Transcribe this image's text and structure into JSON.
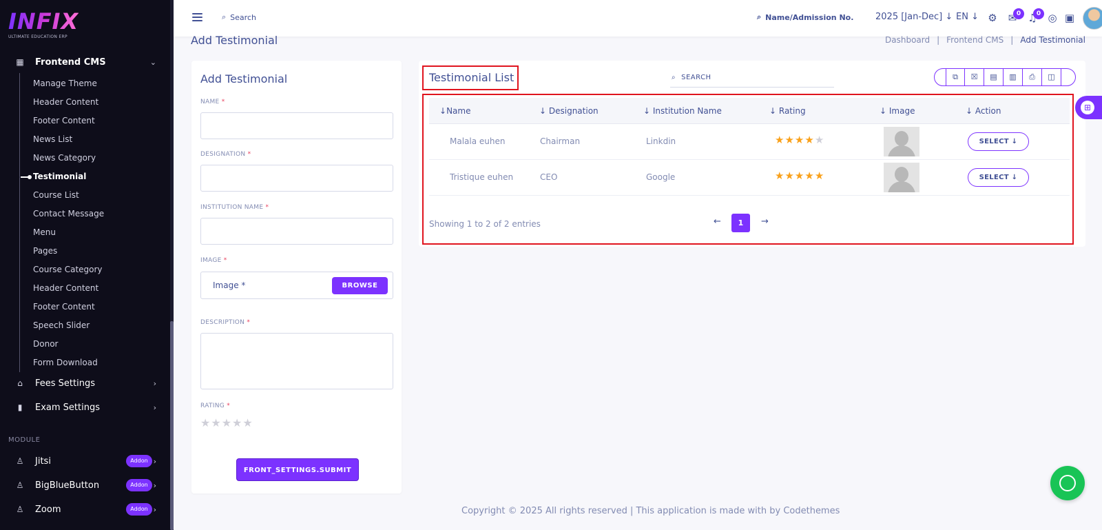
{
  "brand": {
    "logo": "INFIX",
    "tagline": "ULTIMATE EDUCATION ERP"
  },
  "sidebar": {
    "group_frontend": "Frontend CMS",
    "sub_items": [
      {
        "label": "Manage Theme"
      },
      {
        "label": "Header Content"
      },
      {
        "label": "Footer Content"
      },
      {
        "label": "News List"
      },
      {
        "label": "News Category"
      },
      {
        "label": "Testimonial",
        "active": true
      },
      {
        "label": "Course List"
      },
      {
        "label": "Contact Message"
      },
      {
        "label": "Menu"
      },
      {
        "label": "Pages"
      },
      {
        "label": "Course Category"
      },
      {
        "label": "Header Content"
      },
      {
        "label": "Footer Content"
      },
      {
        "label": "Speech Slider"
      },
      {
        "label": "Donor"
      },
      {
        "label": "Form Download"
      }
    ],
    "group_fees": "Fees Settings",
    "group_exam": "Exam Settings",
    "module_label": "MODULE",
    "modules": [
      {
        "label": "Jitsi",
        "badge": "Addon"
      },
      {
        "label": "BigBlueButton",
        "badge": "Addon"
      },
      {
        "label": "Zoom",
        "badge": "Addon"
      }
    ]
  },
  "topbar": {
    "search_label": "Search",
    "search2_label": "Name/Admission No.",
    "session": "2025 [Jan-Dec]",
    "lang": "EN",
    "chat_badge": "0",
    "notif_badge": "0"
  },
  "page": {
    "title": "Add Testimonial",
    "breadcrumb": [
      "Dashboard",
      "Frontend CMS",
      "Add Testimonial"
    ]
  },
  "form": {
    "heading": "Add Testimonial",
    "name_label": "NAME",
    "designation_label": "DESIGNATION",
    "institution_label": "INSTITUTION NAME",
    "image_label": "IMAGE",
    "image_placeholder": "Image *",
    "browse_label": "BROWSE",
    "description_label": "DESCRIPTION",
    "rating_label": "RATING",
    "rating_value": 0,
    "req_mark": "*",
    "submit_label": "FRONT_SETTINGS.SUBMIT"
  },
  "list": {
    "title": "Testimonial List",
    "search_placeholder": "SEARCH",
    "columns": [
      "Name",
      "Designation",
      "Institution Name",
      "Rating",
      "Image",
      "Action"
    ],
    "rows": [
      {
        "name": "Malala euhen",
        "designation": "Chairman",
        "institution": "Linkdin",
        "rating": 4,
        "action": "SELECT"
      },
      {
        "name": "Tristique euhen",
        "designation": "CEO",
        "institution": "Google",
        "rating": 5,
        "action": "SELECT"
      }
    ],
    "showing": "Showing 1 to 2 of 2 entries",
    "current_page": "1"
  },
  "footer": "Copyright © 2025 All rights reserved | This application is made with by Codethemes",
  "colors": {
    "accent": "#7c32ff",
    "text": "#415094",
    "muted": "#828bb2",
    "highlight": "#e0141e",
    "star": "#f9a11b"
  }
}
